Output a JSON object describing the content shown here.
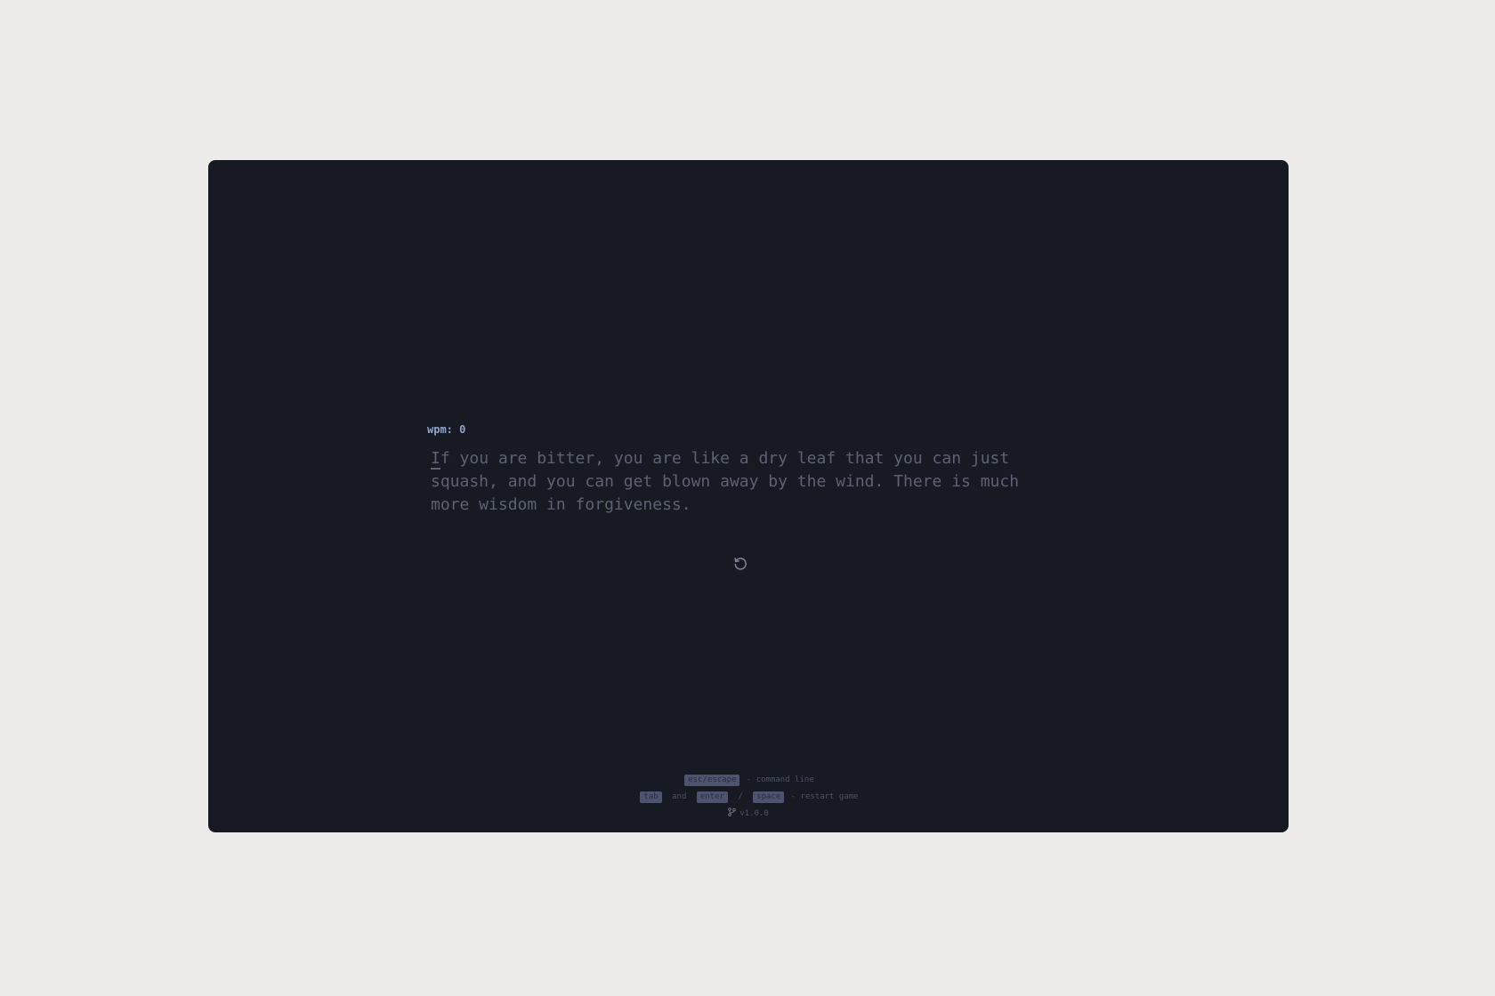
{
  "stats": {
    "wpm_label": "wpm: 0"
  },
  "quote": {
    "current_char": "I",
    "remaining_text": "f you are bitter, you are like a dry leaf that you can just squash, and you can get blown away by the wind. There is much more wisdom in forgiveness."
  },
  "controls": {
    "restart_icon": "restart-icon"
  },
  "footer": {
    "line1": {
      "key": "esc/escape",
      "text": "- command line"
    },
    "line2": {
      "key1": "tab",
      "and_text": "and",
      "key2": "enter",
      "slash": "/",
      "key3": "space",
      "text": "- restart game"
    },
    "version": {
      "icon": "git-branch-icon",
      "text": "v1.0.0"
    }
  },
  "colors": {
    "page_bg": "#edecea",
    "app_bg": "#171a22",
    "wpm": "#8fa6cc",
    "untyped_text": "#5c6274",
    "key_bg": "#4e5470",
    "footer_text": "#4c5264"
  }
}
